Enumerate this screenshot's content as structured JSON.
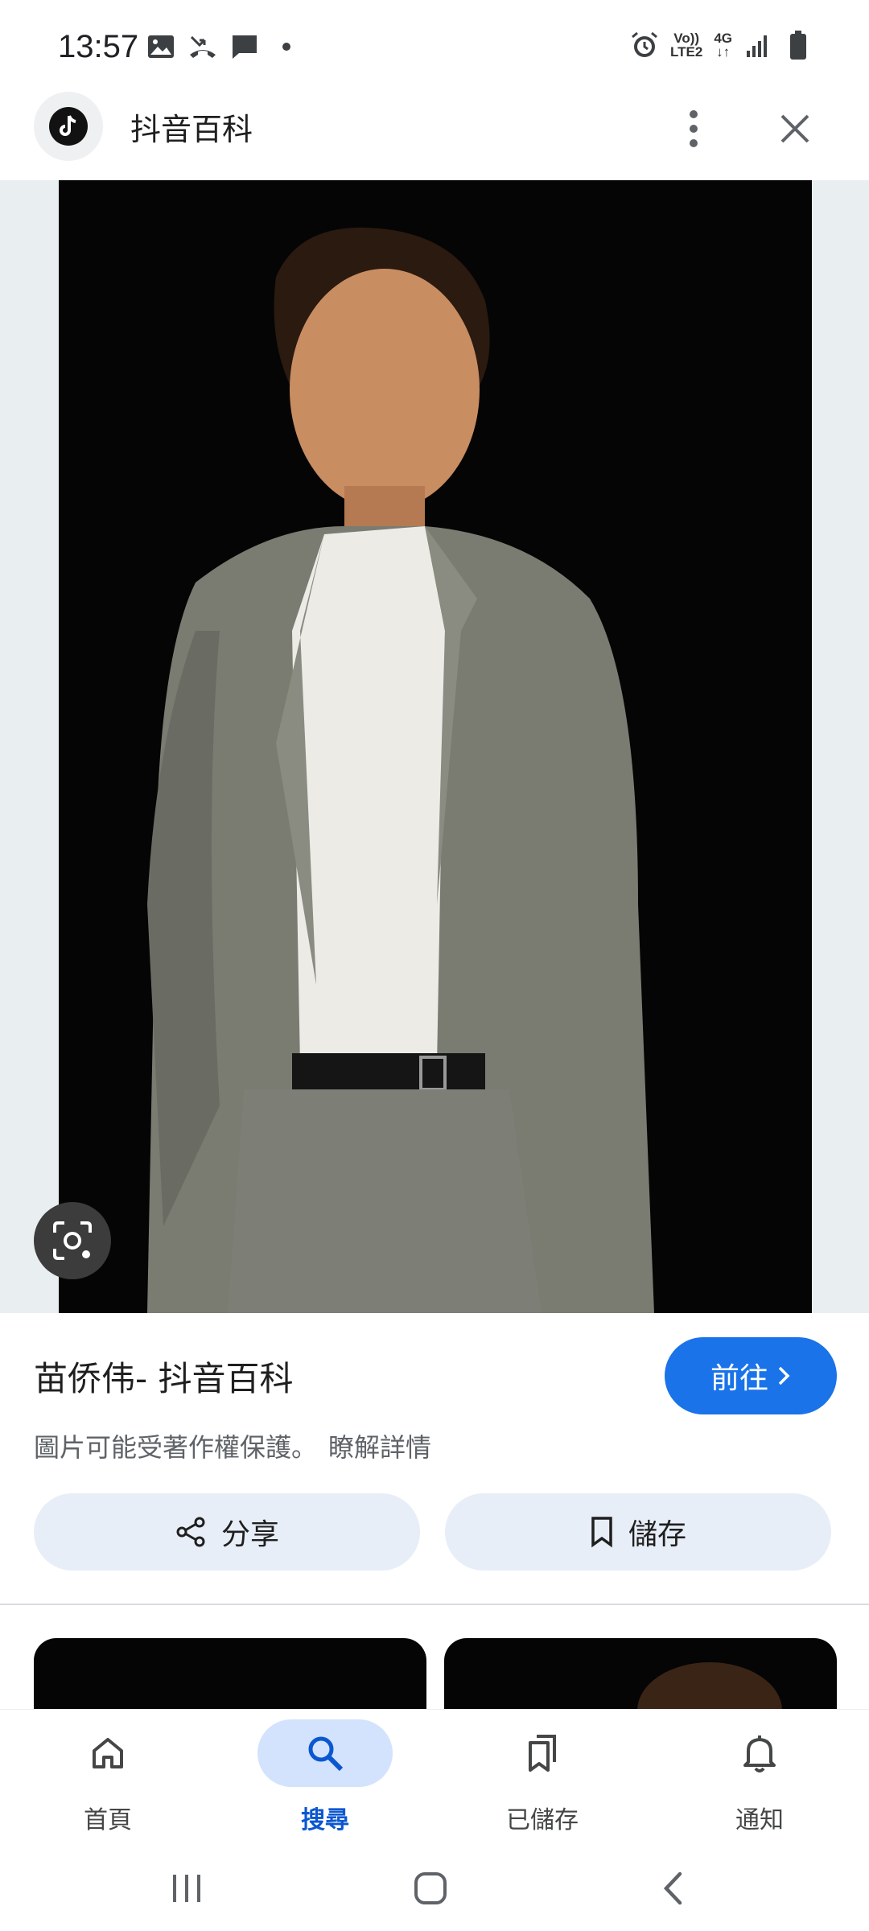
{
  "status_bar": {
    "time": "13:57",
    "network_volte": "Vo))",
    "network_lte": "LTE2",
    "network_4g": "4G",
    "icons_left": [
      "image-icon",
      "missed-call-icon",
      "chat-icon",
      "dot-icon"
    ],
    "icons_right": [
      "alarm-icon",
      "signal-icon",
      "battery-icon"
    ]
  },
  "header": {
    "site_name": "抖音百科",
    "logo_icon": "tiktok-icon"
  },
  "image_result": {
    "title": "苗侨伟- 抖音百科",
    "visit_label": "前往",
    "copyright_notice": "圖片可能受著作權保護。",
    "learn_more": "瞭解詳情",
    "share_label": "分享",
    "save_label": "儲存"
  },
  "bottom_nav": {
    "items": [
      {
        "label": "首頁",
        "icon": "home-icon",
        "active": false
      },
      {
        "label": "搜尋",
        "icon": "search-icon",
        "active": true
      },
      {
        "label": "已儲存",
        "icon": "bookmarks-icon",
        "active": false
      },
      {
        "label": "通知",
        "icon": "bell-icon",
        "active": false
      }
    ]
  },
  "colors": {
    "accent": "#1a73e8",
    "active_nav": "#0b57d0",
    "button_bg": "#e8eef8",
    "image_bg": "#e9eef0"
  }
}
